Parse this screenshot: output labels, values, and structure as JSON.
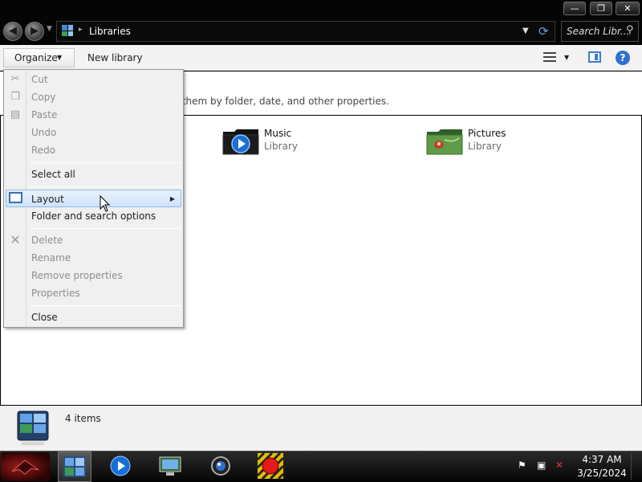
{
  "window": {
    "minimize_label": "—",
    "maximize_label": "❐",
    "close_label": "✕"
  },
  "address": {
    "location": "Libraries",
    "separator": "▸",
    "search_placeholder": "Search Libr..."
  },
  "toolbar": {
    "organize_label": "Organize",
    "new_library_label": "New library"
  },
  "content": {
    "subtitle": "ge them by folder, date, and other properties.",
    "libraries": [
      {
        "name": "Music",
        "type": "Library"
      },
      {
        "name": "Pictures",
        "type": "Library"
      }
    ]
  },
  "details": {
    "count": "4 items"
  },
  "menu": {
    "items": [
      {
        "label": "Cut",
        "icon": "scissors-icon",
        "enabled": false
      },
      {
        "label": "Copy",
        "icon": "copy-icon",
        "enabled": false
      },
      {
        "label": "Paste",
        "icon": "clipboard-icon",
        "enabled": false
      },
      {
        "label": "Undo",
        "enabled": false
      },
      {
        "label": "Redo",
        "enabled": false
      },
      {
        "label": "Select all",
        "enabled": true
      },
      {
        "label": "Layout",
        "icon": "layout-icon",
        "enabled": true,
        "submenu": true,
        "highlighted": true
      },
      {
        "label": "Folder and search options",
        "enabled": true
      },
      {
        "label": "Delete",
        "icon": "delete-x-icon",
        "enabled": false
      },
      {
        "label": "Rename",
        "enabled": false
      },
      {
        "label": "Remove properties",
        "enabled": false
      },
      {
        "label": "Properties",
        "enabled": false
      },
      {
        "label": "Close",
        "enabled": true
      }
    ]
  },
  "taskbar": {
    "clock_time": "4:37 AM",
    "clock_date": "3/25/2024",
    "tray_icons": [
      "flag-icon",
      "network-icon",
      "volume-muted-icon"
    ]
  },
  "colors": {
    "highlight": "#cfe3fa",
    "accent_blue": "#2f6fcf",
    "chrome_dark": "#050505"
  }
}
